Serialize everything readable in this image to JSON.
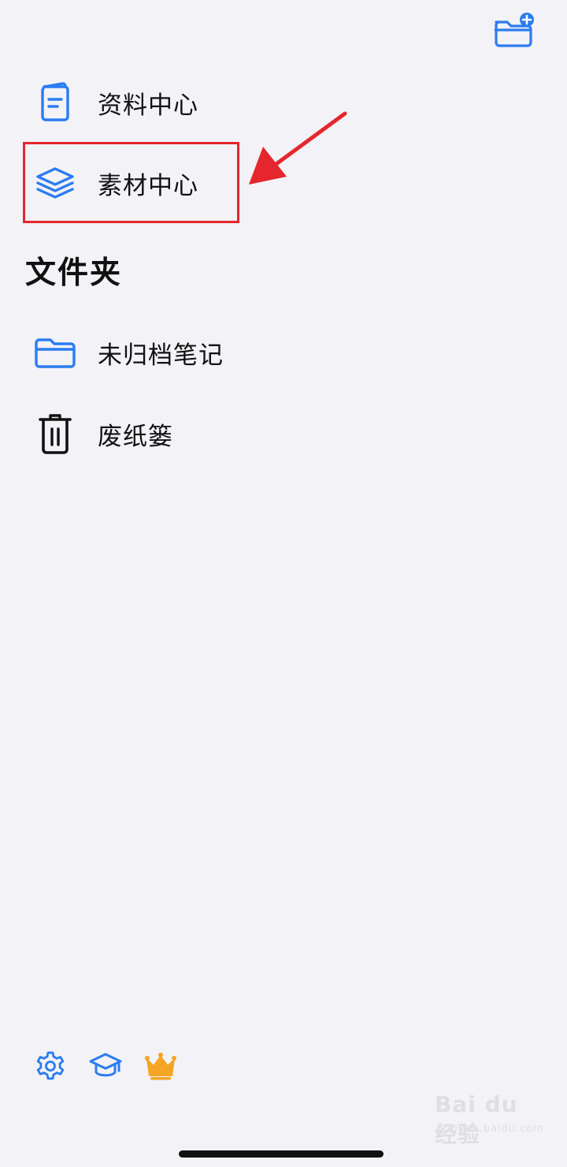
{
  "nav": {
    "items": [
      {
        "label": "资料中心",
        "icon": "document-book-icon"
      },
      {
        "label": "素材中心",
        "icon": "layers-icon"
      }
    ]
  },
  "folders": {
    "title": "文件夹",
    "items": [
      {
        "label": "未归档笔记",
        "icon": "folder-icon"
      },
      {
        "label": "废纸篓",
        "icon": "trash-icon"
      }
    ]
  },
  "toolbar": {
    "new_folder_icon": "new-folder-icon"
  },
  "bottom_bar": {
    "icons": [
      "gear-icon",
      "graduation-cap-icon",
      "crown-icon"
    ]
  },
  "watermark": {
    "main": "Bai du 经验",
    "sub": "jingyan.baidu.com"
  },
  "colors": {
    "accent": "#2b7cf0",
    "highlight": "#e5262c",
    "crown": "#f5a524",
    "background": "#f2f2f7"
  }
}
